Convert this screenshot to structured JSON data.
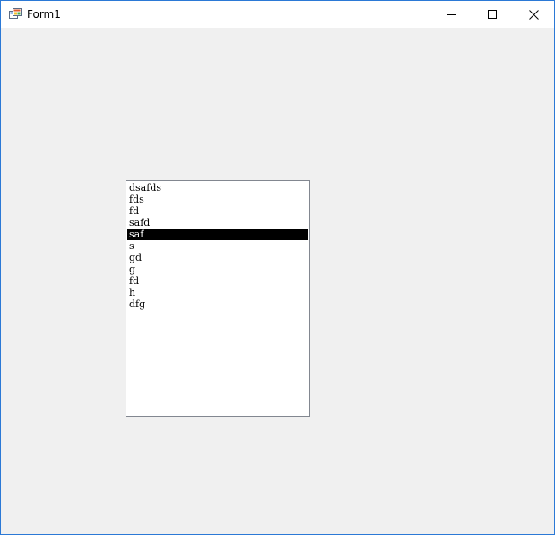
{
  "window": {
    "title": "Form1",
    "icon": "winforms-app-icon",
    "controls": {
      "minimize": "minimize-icon",
      "maximize": "maximize-icon",
      "close": "close-icon"
    },
    "accent_color": "#2b79d6"
  },
  "listbox": {
    "items": [
      {
        "text": "dsafds",
        "selected": false
      },
      {
        "text": "fds",
        "selected": false
      },
      {
        "text": "fd",
        "selected": false
      },
      {
        "text": "safd",
        "selected": false
      },
      {
        "text": "saf",
        "selected": true
      },
      {
        "text": "s",
        "selected": false
      },
      {
        "text": "gd",
        "selected": false
      },
      {
        "text": "g",
        "selected": false
      },
      {
        "text": "fd",
        "selected": false
      },
      {
        "text": "h",
        "selected": false
      },
      {
        "text": "dfg",
        "selected": false
      }
    ],
    "selection_color": "#000000"
  }
}
